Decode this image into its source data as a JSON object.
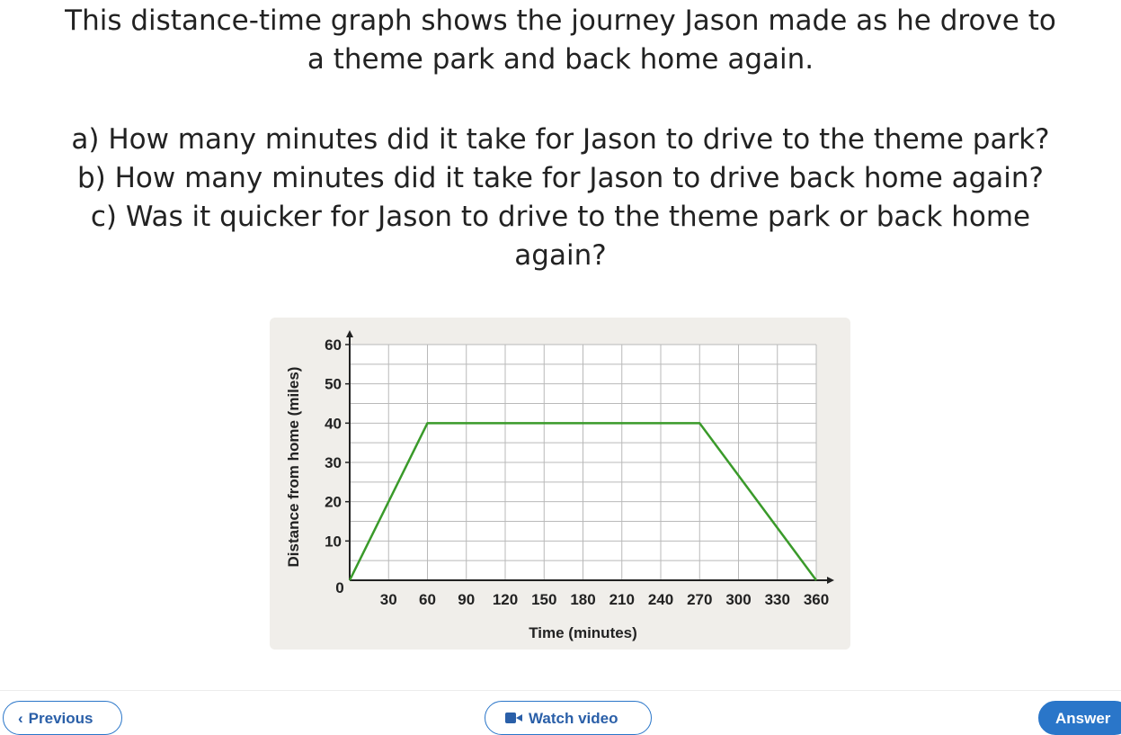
{
  "question": {
    "intro_line1": "This distance-time graph shows the journey Jason made as he drove to",
    "intro_line2": "a theme park and back home again.",
    "part_a": "a) How many minutes did it take for Jason to drive to the theme park?",
    "part_b": "b) How many minutes did it take for Jason to drive back home again?",
    "part_c_line1": "c) Was it quicker for Jason to drive to the theme park or back home",
    "part_c_line2": "again?"
  },
  "chart_data": {
    "type": "line",
    "xlabel": "Time (minutes)",
    "ylabel": "Distance from home (miles)",
    "xlim": [
      0,
      360
    ],
    "ylim": [
      0,
      60
    ],
    "x_ticks": [
      30,
      60,
      90,
      120,
      150,
      180,
      210,
      240,
      270,
      300,
      330,
      360
    ],
    "y_ticks": [
      10,
      20,
      30,
      40,
      50,
      60
    ],
    "origin_label": "0",
    "grid": true,
    "x_minor_step": 30,
    "y_minor_step": 5,
    "series": [
      {
        "x": [
          0,
          60,
          270,
          360
        ],
        "y": [
          0,
          40,
          40,
          0
        ],
        "color": "#3a9a2a"
      }
    ]
  },
  "footer": {
    "previous_label": "Previous",
    "previous_icon": "chevron-left-icon",
    "video_label": "Watch video",
    "video_icon": "video-camera-icon",
    "answer_label": "Answer"
  },
  "colors": {
    "accent": "#2a76c9",
    "line": "#3a9a2a",
    "card_bg": "#f0eeea"
  }
}
